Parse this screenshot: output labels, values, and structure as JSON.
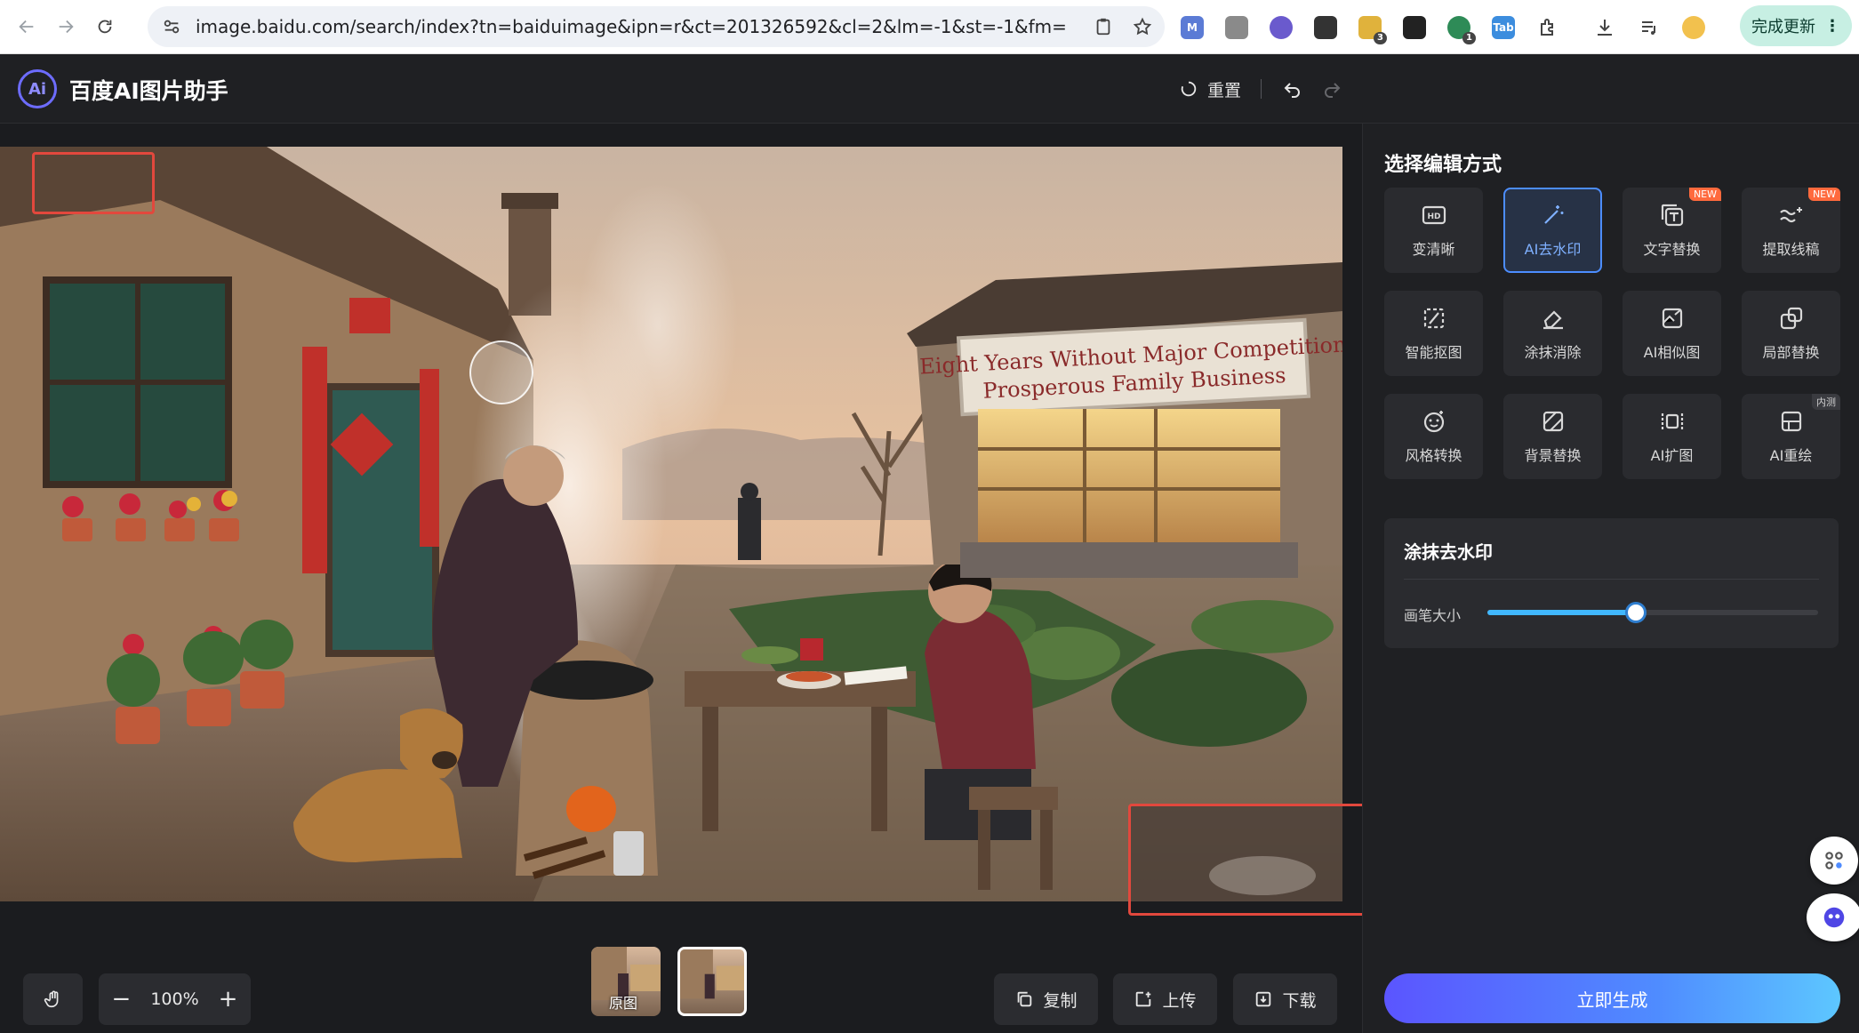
{
  "browser": {
    "url": "image.baidu.com/search/index?tn=baiduimage&ipn=r&ct=201326592&cl=2&lm=-1&st=-1&fm=detail&hs...",
    "update_label": "完成更新",
    "extensions": [
      {
        "name": "m-ext",
        "text": "M",
        "color": "#5b7bd5"
      },
      {
        "name": "doc-ext",
        "text": "",
        "color": "#777777"
      },
      {
        "name": "face-ext",
        "text": "",
        "color": "#6a5acd"
      },
      {
        "name": "qr-ext",
        "text": "",
        "color": "#333333"
      },
      {
        "name": "key-ext",
        "text": "",
        "color": "#e0b23c",
        "badge": "3"
      },
      {
        "name": "mask-ext",
        "text": "",
        "color": "#222222"
      },
      {
        "name": "shield-ext",
        "text": "",
        "color": "#2e8b57",
        "badge": "1"
      },
      {
        "name": "tab-ext",
        "text": "Tab",
        "color": "#3c8dde"
      }
    ]
  },
  "app": {
    "title": "百度AI图片助手",
    "logo_text": "Ai",
    "reset_label": "重置"
  },
  "canvas": {
    "zoom_label": "100%",
    "thumb_original_label": "原图",
    "copy_label": "复制",
    "upload_label": "上传",
    "download_label": "下载",
    "sign_line1": "Eight Years Without Major Competition",
    "sign_line2": "Prosperous Family Business"
  },
  "panel": {
    "title": "选择编辑方式",
    "tools": [
      {
        "name": "enhance",
        "label": "变清晰",
        "icon": "hd-icon"
      },
      {
        "name": "ai-remove-watermark",
        "label": "AI去水印",
        "icon": "magic-wand-icon",
        "active": true
      },
      {
        "name": "text-replace",
        "label": "文字替换",
        "icon": "text-replace-icon",
        "tag": "NEW"
      },
      {
        "name": "extract-lineart",
        "label": "提取线稿",
        "icon": "lineart-icon",
        "tag": "NEW"
      },
      {
        "name": "smart-cutout",
        "label": "智能抠图",
        "icon": "cutout-icon"
      },
      {
        "name": "erase",
        "label": "涂抹消除",
        "icon": "eraser-icon"
      },
      {
        "name": "ai-similar",
        "label": "AI相似图",
        "icon": "similar-image-icon"
      },
      {
        "name": "partial-replace",
        "label": "局部替换",
        "icon": "partial-replace-icon"
      },
      {
        "name": "style-transfer",
        "label": "风格转换",
        "icon": "style-icon"
      },
      {
        "name": "bg-replace",
        "label": "背景替换",
        "icon": "background-icon"
      },
      {
        "name": "ai-expand",
        "label": "AI扩图",
        "icon": "expand-icon"
      },
      {
        "name": "ai-redraw",
        "label": "AI重绘",
        "icon": "redraw-icon",
        "tag": "内测"
      }
    ],
    "settings_title": "涂抹去水印",
    "brush_label": "画笔大小",
    "brush_value": 0.45,
    "generate_label": "立即生成"
  }
}
